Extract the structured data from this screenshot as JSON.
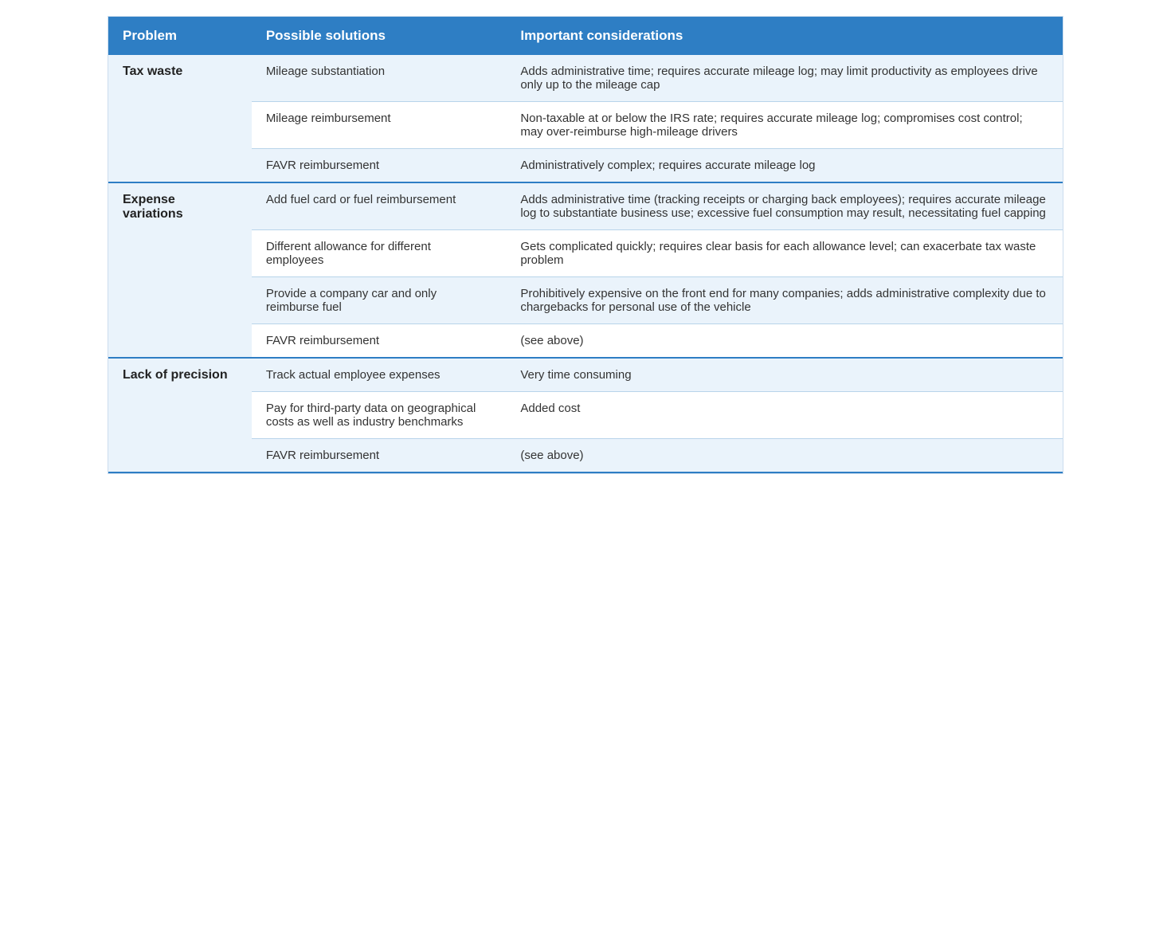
{
  "table": {
    "headers": {
      "problem": "Problem",
      "solutions": "Possible solutions",
      "considerations": "Important considerations"
    },
    "groups": [
      {
        "problem": "Tax waste",
        "rows": [
          {
            "solution": "Mileage substantiation",
            "consideration": "Adds administrative time; requires accurate mileage log; may limit productivity as employees drive only up to the mileage cap"
          },
          {
            "solution": "Mileage reimbursement",
            "consideration": "Non-taxable at or below the IRS rate; requires accurate mileage log; compromises cost control; may over-reimburse high-mileage drivers"
          },
          {
            "solution": "FAVR reimbursement",
            "consideration": "Administratively complex; requires accurate mileage log"
          }
        ]
      },
      {
        "problem": "Expense variations",
        "rows": [
          {
            "solution": "Add fuel card or fuel reimbursement",
            "consideration": "Adds administrative time (tracking receipts or charging back employees); requires accurate mileage log to substantiate business use; excessive fuel consumption may result, necessitating fuel capping"
          },
          {
            "solution": "Different allowance for different employees",
            "consideration": "Gets complicated quickly; requires clear basis for each allowance level; can exacerbate tax waste problem"
          },
          {
            "solution": "Provide a company car and only reimburse fuel",
            "consideration": "Prohibitively expensive on the front end for many companies; adds administrative complexity due to chargebacks for personal use of the vehicle"
          },
          {
            "solution": "FAVR reimbursement",
            "consideration": "(see above)"
          }
        ]
      },
      {
        "problem": "Lack of precision",
        "rows": [
          {
            "solution": "Track actual employee expenses",
            "consideration": "Very time consuming"
          },
          {
            "solution": "Pay for third-party data on geographical costs as well as industry benchmarks",
            "consideration": "Added cost"
          },
          {
            "solution": "FAVR reimbursement",
            "consideration": "(see above)"
          }
        ]
      }
    ]
  }
}
